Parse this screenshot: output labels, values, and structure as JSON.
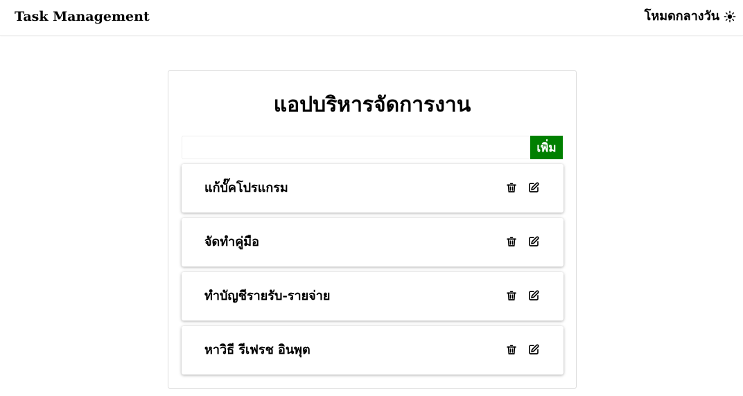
{
  "navbar": {
    "brand": "Task Management",
    "mode_label": "โหมดกลางวัน",
    "mode_icon": "sun-icon"
  },
  "app": {
    "title": "แอปบริหารจัดการงาน",
    "input": {
      "value": "",
      "placeholder": ""
    },
    "add_label": "เพิ่ม",
    "add_color": "#008000"
  },
  "tasks": [
    {
      "label": "แก้บั๊คโปรแกรม",
      "delete_icon": "trash-icon",
      "edit_icon": "edit-icon"
    },
    {
      "label": "จัดทำคู่มือ",
      "delete_icon": "trash-icon",
      "edit_icon": "edit-icon"
    },
    {
      "label": "ทำบัญชีรายรับ-รายจ่าย",
      "delete_icon": "trash-icon",
      "edit_icon": "edit-icon"
    },
    {
      "label": "หาวิธี รีเฟรช อินพุต",
      "delete_icon": "trash-icon",
      "edit_icon": "edit-icon"
    }
  ]
}
